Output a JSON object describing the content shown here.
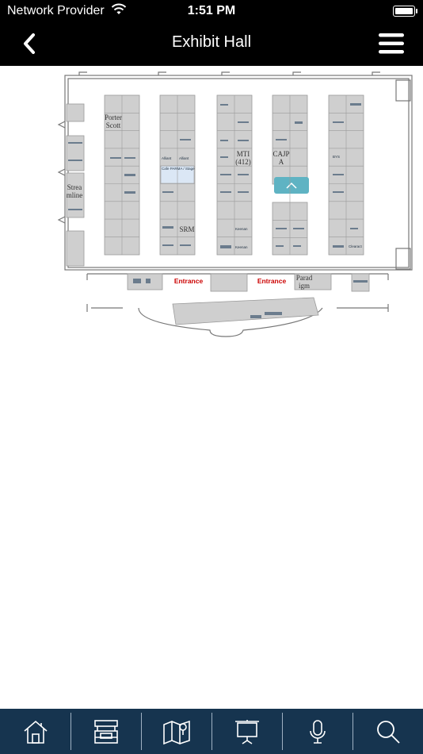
{
  "status_bar": {
    "carrier": "Network Provider",
    "time": "1:51 PM"
  },
  "header": {
    "title": "Exhibit Hall"
  },
  "map": {
    "booth_labels": {
      "porter_scott_1": "Porter",
      "porter_scott_2": "Scott",
      "streamline_1": "Strea",
      "streamline_2": "mline",
      "srm": "SRM",
      "mti_1": "MTI",
      "mti_2": "(412)",
      "cajpa_1": "CAJP",
      "cajpa_2": "A",
      "paradigm_1": "Parad",
      "paradigm_2": "igm"
    },
    "entrance_left": "Entrance",
    "entrance_right": "Entrance",
    "logos": {
      "alliant_1": "Alliant",
      "alliant_2": "Alliant",
      "cafe": "Cafe PARMA / Stage",
      "keenan_1": "Keenan",
      "keenan_2": "Keenan",
      "bys": "BYS",
      "clearact": "Clearact"
    }
  },
  "tabs": [
    {
      "name": "home",
      "icon": "home-icon"
    },
    {
      "name": "exhibitors",
      "icon": "booth-icon"
    },
    {
      "name": "map",
      "icon": "map-icon"
    },
    {
      "name": "presentations",
      "icon": "presentation-icon"
    },
    {
      "name": "speakers",
      "icon": "microphone-icon"
    },
    {
      "name": "search",
      "icon": "search-icon"
    }
  ],
  "colors": {
    "bar": "#000000",
    "tabbar": "#16344f",
    "entrance": "#cc0000",
    "booth": "#cfcfcf",
    "highlight": "#5fb3c3"
  }
}
